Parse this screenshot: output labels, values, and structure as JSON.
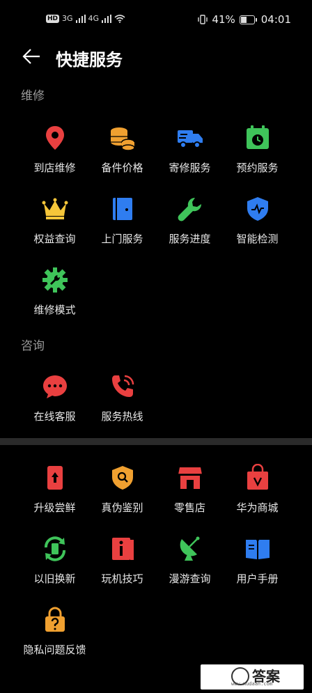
{
  "status_bar": {
    "network_badge": "HD",
    "sim1_label": "3G",
    "sim2_label": "4G",
    "battery": "41%",
    "time": "04:01"
  },
  "header": {
    "title": "快捷服务"
  },
  "sections": {
    "repair": {
      "label": "维修",
      "items": [
        "到店维修",
        "备件价格",
        "寄修服务",
        "预约服务",
        "权益查询",
        "上门服务",
        "服务进度",
        "智能检测",
        "维修模式"
      ]
    },
    "consult": {
      "label": "咨询",
      "items": [
        "在线客服",
        "服务热线"
      ]
    },
    "more": {
      "items": [
        "升级尝鲜",
        "真伪鉴别",
        "零售店",
        "华为商城",
        "以旧换新",
        "玩机技巧",
        "漫游查询",
        "用户手册",
        "隐私问题反馈"
      ]
    }
  },
  "watermark": {
    "text": "答案",
    "url": "www.mudaan.com"
  },
  "colors": {
    "red": "#e94040",
    "orange": "#f0a030",
    "blue": "#2f7df0",
    "green": "#3fc45a",
    "yellow": "#f5c63a"
  }
}
